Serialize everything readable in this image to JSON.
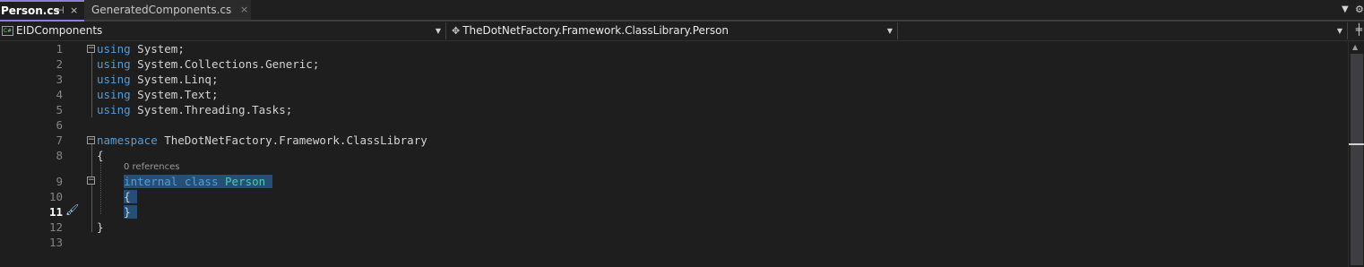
{
  "tabs": {
    "active_label": "Person.cs",
    "inactive_label": "GeneratedComponents.cs",
    "pin_glyph": "⊣",
    "close_glyph": "×"
  },
  "navbar": {
    "project": "EIDComponents",
    "type": "TheDotNetFactory.Framework.ClassLibrary.Person",
    "member": ""
  },
  "editor": {
    "codelens_refs": "0 references",
    "current_line": 11,
    "colors": {
      "keyword": "#569cd6",
      "type": "#4ec9b0",
      "selection": "#264f78"
    }
  },
  "lines": [
    {
      "n": "1",
      "parts": [
        {
          "c": "kw",
          "t": "using"
        },
        {
          "c": "tx",
          "t": " System;"
        }
      ]
    },
    {
      "n": "2",
      "parts": [
        {
          "c": "kw",
          "t": "using"
        },
        {
          "c": "tx",
          "t": " System.Collections.Generic;"
        }
      ]
    },
    {
      "n": "3",
      "parts": [
        {
          "c": "kw",
          "t": "using"
        },
        {
          "c": "tx",
          "t": " System.Linq;"
        }
      ]
    },
    {
      "n": "4",
      "parts": [
        {
          "c": "kw",
          "t": "using"
        },
        {
          "c": "tx",
          "t": " System.Text;"
        }
      ]
    },
    {
      "n": "5",
      "parts": [
        {
          "c": "kw",
          "t": "using"
        },
        {
          "c": "tx",
          "t": " System.Threading.Tasks;"
        }
      ]
    },
    {
      "n": "6",
      "parts": []
    },
    {
      "n": "7",
      "parts": [
        {
          "c": "kw",
          "t": "namespace"
        },
        {
          "c": "tx",
          "t": " TheDotNetFactory.Framework.ClassLibrary"
        }
      ]
    },
    {
      "n": "8",
      "parts": [
        {
          "c": "tx",
          "t": "{"
        }
      ]
    },
    {
      "n": "9",
      "parts": [
        {
          "c": "tx",
          "t": "    "
        },
        {
          "c": "kw sel",
          "t": "internal"
        },
        {
          "c": "tx sel",
          "t": " "
        },
        {
          "c": "kw sel",
          "t": "class"
        },
        {
          "c": "tx sel",
          "t": " "
        },
        {
          "c": "type sel",
          "t": "Person"
        },
        {
          "c": "tx sel",
          "t": " "
        }
      ]
    },
    {
      "n": "10",
      "parts": [
        {
          "c": "tx",
          "t": "    "
        },
        {
          "c": "tx sel",
          "t": "{ "
        }
      ]
    },
    {
      "n": "11",
      "parts": [
        {
          "c": "tx",
          "t": "    "
        },
        {
          "c": "tx sel",
          "t": "} "
        }
      ]
    },
    {
      "n": "12",
      "parts": [
        {
          "c": "tx",
          "t": "}"
        }
      ]
    },
    {
      "n": "13",
      "parts": []
    }
  ]
}
